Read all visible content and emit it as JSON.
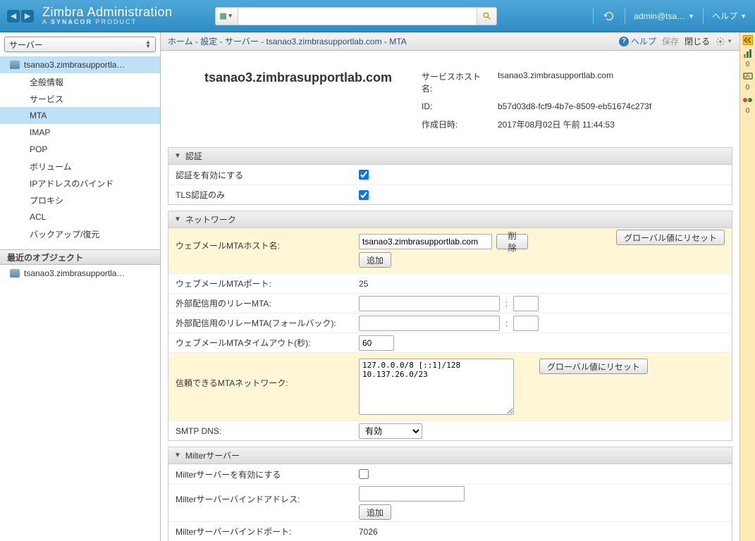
{
  "header": {
    "brand_title": "Zimbra Administration",
    "brand_sub_prefix": "A ",
    "brand_sub_bold": "SYNACOR",
    "brand_sub_suffix": " PRODUCT",
    "search_value": "",
    "search_placeholder": "",
    "user_label": "admin@tsa…",
    "help_label": "ヘルプ"
  },
  "sidebar": {
    "selector_label": "サーバー",
    "items": [
      {
        "label": "tsanao3.zimbrasupportla…"
      },
      {
        "label": "全般情報"
      },
      {
        "label": "サービス"
      },
      {
        "label": "MTA"
      },
      {
        "label": "IMAP"
      },
      {
        "label": "POP"
      },
      {
        "label": "ボリューム"
      },
      {
        "label": "IPアドレスのバインド"
      },
      {
        "label": "プロキシ"
      },
      {
        "label": "ACL"
      },
      {
        "label": "バックアップ/復元"
      }
    ],
    "selected_index": 3,
    "recent_header": "最近のオブジェクト",
    "recent_items": [
      {
        "label": "tsanao3.zimbrasupportla…"
      }
    ]
  },
  "breadcrumb": {
    "text": "ホーム - 設定 - サーバー - tsanao3.zimbrasupportlab.com - MTA",
    "help_label": "ヘルプ",
    "save_label": "保存",
    "close_label": "閉じる"
  },
  "right_rail": {
    "count1": "0",
    "count2": "0",
    "count3": "0"
  },
  "summary": {
    "server_heading": "tsanao3.zimbrasupportlab.com",
    "rows": {
      "host_label": "サービスホスト名:",
      "host_value": "tsanao3.zimbrasupportlab.com",
      "id_label": "ID:",
      "id_value": "b57d03d8-fcf9-4b7e-8509-eb51674c273f",
      "created_label": "作成日時:",
      "created_value": "2017年08月02日 午前 11:44:53"
    }
  },
  "sections": {
    "auth": {
      "title": "認証",
      "enable_label": "認証を有効にする",
      "enable_checked": true,
      "tls_label": "TLS認証のみ",
      "tls_checked": true
    },
    "network": {
      "title": "ネットワーク",
      "webmail_host_label": "ウェブメールMTAホスト名:",
      "webmail_host_value": "tsanao3.zimbrasupportlab.com",
      "delete_btn": "削除",
      "add_btn": "追加",
      "reset_btn": "グローバル値にリセット",
      "webmail_port_label": "ウェブメールMTAポート:",
      "webmail_port_value": "25",
      "relay_label": "外部配信用のリレーMTA:",
      "relay_host": "",
      "relay_port": "",
      "relay_fb_label": "外部配信用のリレーMTA(フォールバック):",
      "relay_fb_host": "",
      "relay_fb_port": "",
      "timeout_label": "ウェブメールMTAタイムアウト(秒):",
      "timeout_value": "60",
      "trusted_label": "信頼できるMTAネットワーク:",
      "trusted_value": "127.0.0.0/8 [::1]/128 10.137.26.0/23",
      "trusted_reset_btn": "グローバル値にリセット",
      "smtpdns_label": "SMTP DNS:",
      "smtpdns_value": "有効"
    },
    "milter": {
      "title": "Milterサーバー",
      "enable_label": "Milterサーバーを有効にする",
      "enable_checked": false,
      "bind_addr_label": "Milterサーバーバインドアドレス:",
      "bind_addr_value": "",
      "add_btn": "追加",
      "bind_port_label": "Milterサーバーバインドポート:",
      "bind_port_value": "7026"
    }
  }
}
